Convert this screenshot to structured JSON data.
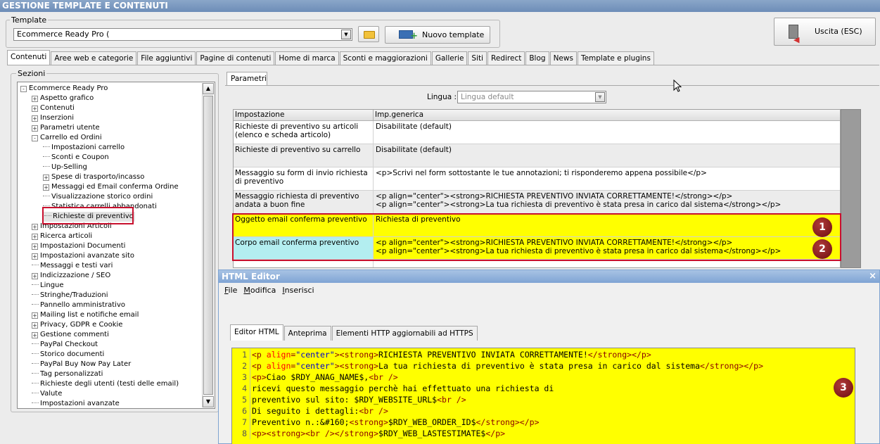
{
  "window": {
    "title": "GESTIONE TEMPLATE E CONTENUTI"
  },
  "template": {
    "label": "Template",
    "selected": "Ecommerce Ready Pro (",
    "new_button": "Nuovo template",
    "exit_button": "Uscita (ESC)"
  },
  "main_tabs": [
    "Contenuti",
    "Aree web e categorie",
    "File aggiuntivi",
    "Pagine di contenuti",
    "Home di marca",
    "Sconti e maggiorazioni",
    "Gallerie",
    "Siti",
    "Redirect",
    "Blog",
    "News",
    "Template e plugins"
  ],
  "sections": {
    "label": "Sezioni",
    "items": [
      {
        "text": "Ecommerce Ready Pro",
        "level": 0,
        "expander": "-"
      },
      {
        "text": "Aspetto grafico",
        "level": 1,
        "expander": "+"
      },
      {
        "text": "Contenuti",
        "level": 1,
        "expander": "+"
      },
      {
        "text": "Inserzioni",
        "level": 1,
        "expander": "+"
      },
      {
        "text": "Parametri utente",
        "level": 1,
        "expander": "+"
      },
      {
        "text": "Carrello ed Ordini",
        "level": 1,
        "expander": "-"
      },
      {
        "text": "Impostazioni carrello",
        "level": 2,
        "expander": ""
      },
      {
        "text": "Sconti e Coupon",
        "level": 2,
        "expander": ""
      },
      {
        "text": "Up-Selling",
        "level": 2,
        "expander": ""
      },
      {
        "text": "Spese di trasporto/incasso",
        "level": 2,
        "expander": "+"
      },
      {
        "text": "Messaggi ed Email conferma Ordine",
        "level": 2,
        "expander": "+"
      },
      {
        "text": "Visualizzazione storico ordini",
        "level": 2,
        "expander": ""
      },
      {
        "text": "Statistica carrelli abbandonati",
        "level": 2,
        "expander": ""
      },
      {
        "text": "Richieste di preventivo",
        "level": 2,
        "expander": "",
        "selected": true
      },
      {
        "text": "Impostazioni Articoli",
        "level": 1,
        "expander": "+"
      },
      {
        "text": "Ricerca articoli",
        "level": 1,
        "expander": "+"
      },
      {
        "text": "Impostazioni Documenti",
        "level": 1,
        "expander": "+"
      },
      {
        "text": "Impostazioni avanzate sito",
        "level": 1,
        "expander": "+"
      },
      {
        "text": "Messaggi e testi vari",
        "level": 1,
        "expander": ""
      },
      {
        "text": "Indicizzazione / SEO",
        "level": 1,
        "expander": "+"
      },
      {
        "text": "Lingue",
        "level": 1,
        "expander": ""
      },
      {
        "text": "Stringhe/Traduzioni",
        "level": 1,
        "expander": ""
      },
      {
        "text": "Pannello amministrativo",
        "level": 1,
        "expander": ""
      },
      {
        "text": "Mailing list e notifiche email",
        "level": 1,
        "expander": "+"
      },
      {
        "text": "Privacy, GDPR e Cookie",
        "level": 1,
        "expander": "+"
      },
      {
        "text": "Gestione commenti",
        "level": 1,
        "expander": "+"
      },
      {
        "text": "PayPal Checkout",
        "level": 1,
        "expander": ""
      },
      {
        "text": "Storico documenti",
        "level": 1,
        "expander": ""
      },
      {
        "text": "PayPal Buy Now Pay Later",
        "level": 1,
        "expander": ""
      },
      {
        "text": "Tag personalizzati",
        "level": 1,
        "expander": ""
      },
      {
        "text": "Richieste degli utenti (testi delle email)",
        "level": 1,
        "expander": ""
      },
      {
        "text": "Valute",
        "level": 1,
        "expander": ""
      },
      {
        "text": "Impostazioni avanzate",
        "level": 1,
        "expander": ""
      }
    ]
  },
  "params": {
    "tab": "Parametri",
    "lingua_label": "Lingua :",
    "lingua_value": "Lingua default",
    "columns": [
      "Impostazione",
      "Imp.generica"
    ],
    "rows": [
      {
        "name": "Richieste di preventivo su articoli (elenco e scheda articolo)",
        "value": "Disabilitate (default)",
        "value2": ""
      },
      {
        "name": "Richieste di preventivo su carrello",
        "value": "Disabilitate (default)",
        "value2": ""
      },
      {
        "name": "Messaggio su form di invio richiesta di preventivo",
        "value": "<p>Scrivi nel form sottostante le tue annotazioni; ti risponderemo appena possibile</p>",
        "value2": ""
      },
      {
        "name": "Messaggio richiesta di preventivo andata a buon fine",
        "value": "<p align=\"center\"><strong>RICHIESTA PREVENTIVO INVIATA CORRETTAMENTE!</strong></p>",
        "value2": "<p align=\"center\"><strong>La tua richiesta di preventivo è stata presa in carico dal sistema</strong></p>"
      },
      {
        "name": "Oggetto email conferma preventivo",
        "value": "Richiesta di preventivo",
        "value2": ""
      },
      {
        "name": "Corpo email conferma preventivo",
        "value": "<p align=\"center\"><strong>RICHIESTA PREVENTIVO INVIATA CORRETTAMENTE!</strong></p>",
        "value2": "<p align=\"center\"><strong>La tua richiesta di preventivo è stata presa in carico dal sistema</strong></p>"
      }
    ]
  },
  "badges": [
    "1",
    "2",
    "3"
  ],
  "editor": {
    "title": "HTML Editor",
    "menu": [
      "File",
      "Modifica",
      "Inserisci"
    ],
    "tabs": [
      "Editor HTML",
      "Anteprima",
      "Elementi HTTP aggiornabili ad HTTPS"
    ],
    "lines": [
      {
        "n": "1",
        "parts": [
          [
            "tag",
            "<p "
          ],
          [
            "attr",
            "align"
          ],
          [
            "tag",
            "="
          ],
          [
            "val",
            "\"center\""
          ],
          [
            "tag",
            "><strong>"
          ],
          [
            "txt",
            "RICHIESTA PREVENTIVO INVIATA CORRETTAMENTE!"
          ],
          [
            "tag",
            "</strong></p>"
          ]
        ]
      },
      {
        "n": "2",
        "parts": [
          [
            "tag",
            "<p "
          ],
          [
            "attr",
            "align"
          ],
          [
            "tag",
            "="
          ],
          [
            "val",
            "\"center\""
          ],
          [
            "tag",
            "><strong>"
          ],
          [
            "txt",
            "La tua richiesta di preventivo è stata presa in carico dal sistema"
          ],
          [
            "tag",
            "</strong></p>"
          ]
        ]
      },
      {
        "n": "3",
        "parts": [
          [
            "tag",
            "<p>"
          ],
          [
            "txt",
            "Ciao $RDY_ANAG_NAME$,"
          ],
          [
            "tag",
            "<br />"
          ]
        ]
      },
      {
        "n": "4",
        "parts": [
          [
            "txt",
            "ricevi questo messaggio perchè hai effettuato una richiesta di"
          ]
        ]
      },
      {
        "n": "5",
        "parts": [
          [
            "txt",
            "preventivo sul sito: $RDY_WEBSITE_URL$"
          ],
          [
            "tag",
            "<br />"
          ]
        ]
      },
      {
        "n": "6",
        "parts": [
          [
            "txt",
            "Di seguito i dettagli:"
          ],
          [
            "tag",
            "<br />"
          ]
        ]
      },
      {
        "n": "7",
        "parts": [
          [
            "txt",
            "Preventivo n.:&#160;"
          ],
          [
            "tag",
            "<strong>"
          ],
          [
            "txt",
            "$RDY_WEB_ORDER_ID$"
          ],
          [
            "tag",
            "</strong></p>"
          ]
        ]
      },
      {
        "n": "8",
        "parts": [
          [
            "tag",
            "<p><strong><br /></strong>"
          ],
          [
            "txt",
            "$RDY_WEB_LASTESTIMATE$"
          ],
          [
            "tag",
            "</p>"
          ]
        ]
      }
    ]
  },
  "colors": {
    "highlight": "#ffff00",
    "accent_cyan": "#b3eef0",
    "frame_red": "#c8102e",
    "badge": "#7a1010"
  }
}
